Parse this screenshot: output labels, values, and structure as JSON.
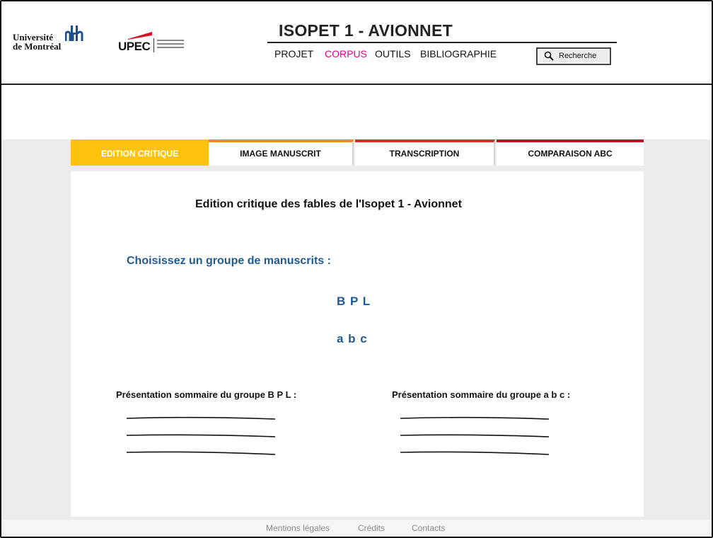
{
  "header": {
    "logos": {
      "udem": {
        "line1": "Université",
        "line2": "de Montréal"
      },
      "upec": {
        "word": "UPEC"
      }
    },
    "site_title": "ISOPET 1 - AVIONNET",
    "nav": [
      {
        "label": "PROJET",
        "active": false
      },
      {
        "label": "CORPUS",
        "active": true
      },
      {
        "label": "OUTILS",
        "active": false
      },
      {
        "label": "BIBLIOGRAPHIE",
        "active": false
      }
    ],
    "search_label": "Recherche",
    "colors": {
      "active_nav": "#e6008f"
    }
  },
  "tabs": [
    {
      "label": "EDITION CRITIQUE",
      "active": true,
      "accent": "#fcc20c"
    },
    {
      "label": "IMAGE MANUSCRIT",
      "active": false,
      "accent": "#f08a1c"
    },
    {
      "label": "TRANSCRIPTION",
      "active": false,
      "accent": "#e02b1f"
    },
    {
      "label": "COMPARAISON ABC",
      "active": false,
      "accent": "#c2101e"
    }
  ],
  "main": {
    "title": "Edition critique des fables de l'Isopet 1 - Avionnet",
    "choose_label": "Choisissez un groupe de manuscrits :",
    "groups": [
      "B P L",
      "a b c"
    ],
    "presentations": [
      {
        "label": "Présentation sommaire du groupe B P L :"
      },
      {
        "label": "Présentation sommaire du groupe a b c :"
      }
    ],
    "colors": {
      "link": "#1f5a93"
    }
  },
  "footer": {
    "links": [
      "Mentions légales",
      "Crédits",
      "Contacts"
    ]
  }
}
